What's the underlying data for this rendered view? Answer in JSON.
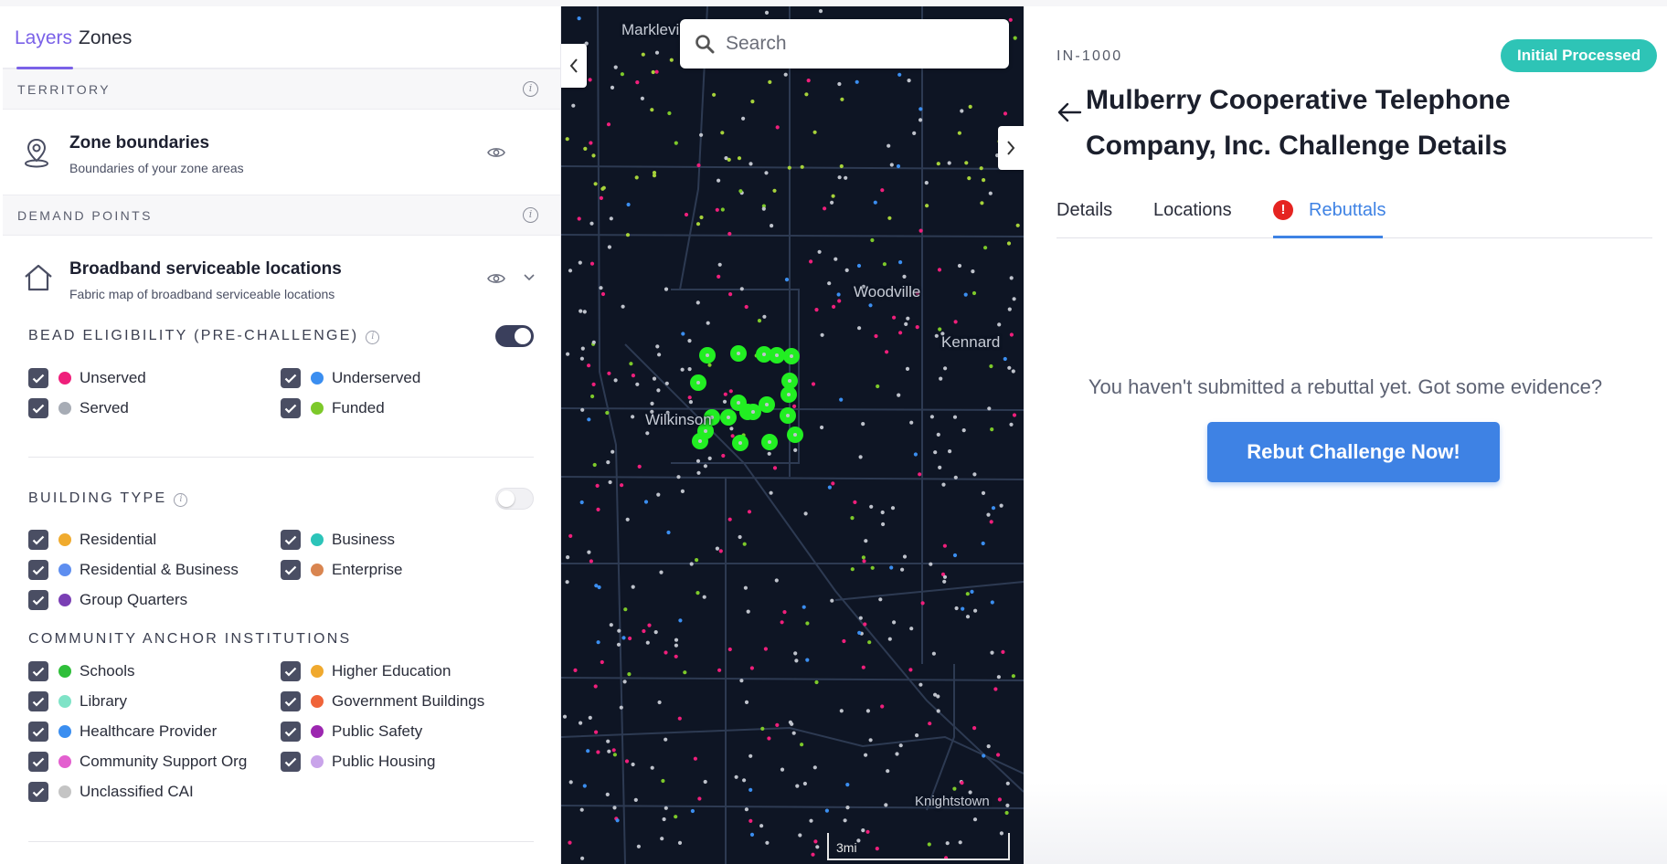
{
  "left_panel": {
    "tabs": [
      "Layers",
      "Zones"
    ],
    "territory": {
      "header": "TERRITORY",
      "layer_title": "Zone boundaries",
      "layer_subtitle": "Boundaries of your zone areas"
    },
    "demand_points": {
      "header": "DEMAND POINTS",
      "layer_title": "Broadband serviceable locations",
      "layer_subtitle": "Fabric map of broadband serviceable locations"
    },
    "bead_eligibility": {
      "title": "BEAD ELIGIBILITY (PRE-CHALLENGE)",
      "toggle_on": true,
      "items": [
        {
          "label": "Unserved",
          "color": "#ef1f7b"
        },
        {
          "label": "Underserved",
          "color": "#3b8ef0"
        },
        {
          "label": "Served",
          "color": "#a7acb5"
        },
        {
          "label": "Funded",
          "color": "#7dc92a"
        }
      ]
    },
    "building_type": {
      "title": "BUILDING TYPE",
      "toggle_on": false,
      "items": [
        {
          "label": "Residential",
          "color": "#f0ab2e"
        },
        {
          "label": "Business",
          "color": "#2cc4b9"
        },
        {
          "label": "Residential & Business",
          "color": "#5e8ef0"
        },
        {
          "label": "Enterprise",
          "color": "#d98550"
        },
        {
          "label": "Group Quarters",
          "color": "#7a3fb4"
        }
      ]
    },
    "community_anchor": {
      "title": "COMMUNITY ANCHOR INSTITUTIONS",
      "items": [
        {
          "label": "Schools",
          "color": "#2fbf3a"
        },
        {
          "label": "Higher Education",
          "color": "#f0a92e"
        },
        {
          "label": "Library",
          "color": "#7fe3c7"
        },
        {
          "label": "Government Buildings",
          "color": "#f0643a"
        },
        {
          "label": "Healthcare Provider",
          "color": "#3b8ef0"
        },
        {
          "label": "Public Safety",
          "color": "#9c27b0"
        },
        {
          "label": "Community Support Org",
          "color": "#e35fcf"
        },
        {
          "label": "Public Housing",
          "color": "#c9a4ea"
        },
        {
          "label": "Unclassified CAI",
          "color": "#c4c4c4"
        }
      ]
    }
  },
  "map": {
    "search_placeholder": "Search",
    "labels": [
      "Markleville",
      "Woodville",
      "Kennard",
      "Wilkinson",
      "Knightstown"
    ],
    "scale_label": "3mi",
    "highlight_color": "#22ee22"
  },
  "detail": {
    "id": "IN-1000",
    "status": "Initial Processed",
    "status_color": "#2ec4b6",
    "title": "Mulberry Cooperative Telephone Company, Inc. Challenge Details",
    "tabs": [
      "Details",
      "Locations",
      "Rebuttals"
    ],
    "active_tab": "Rebuttals",
    "alert_glyph": "!",
    "empty_message": "You haven't submitted a rebuttal yet. Got some evidence?",
    "cta_label": "Rebut Challenge Now!",
    "accent_color": "#3e82e4"
  }
}
